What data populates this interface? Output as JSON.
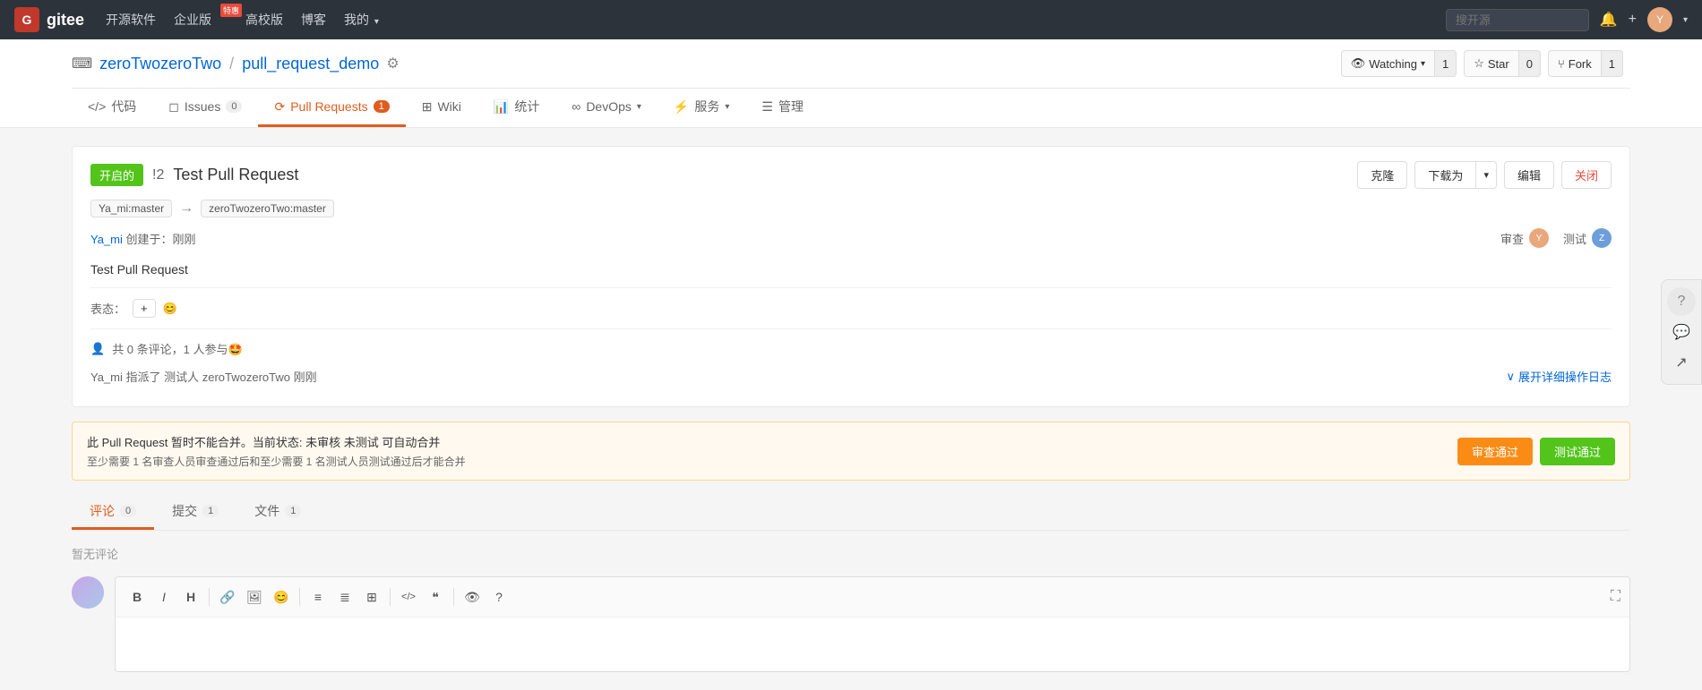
{
  "topnav": {
    "brand": "gitee",
    "logo_letter": "G",
    "links": [
      {
        "label": "开源软件",
        "id": "opensource"
      },
      {
        "label": "企业版",
        "id": "enterprise",
        "badge": "特惠"
      },
      {
        "label": "高校版",
        "id": "edu"
      },
      {
        "label": "博客",
        "id": "blog"
      },
      {
        "label": "我的",
        "id": "mine",
        "dropdown": true
      }
    ],
    "search_placeholder": "搜开源"
  },
  "repo": {
    "icon": "⬛",
    "owner": "zeroTwozeroTwo",
    "name": "pull_request_demo",
    "watching_label": "Watching",
    "watching_count": "1",
    "star_label": "Star",
    "star_count": "0",
    "fork_label": "Fork",
    "fork_count": "1"
  },
  "tabs": [
    {
      "label": "代码",
      "id": "code",
      "badge": null
    },
    {
      "label": "Issues",
      "id": "issues",
      "badge": "0"
    },
    {
      "label": "Pull Requests",
      "id": "pull_requests",
      "badge": "1",
      "active": true
    },
    {
      "label": "Wiki",
      "id": "wiki",
      "badge": null
    },
    {
      "label": "统计",
      "id": "stats",
      "badge": null
    },
    {
      "label": "DevOps",
      "id": "devops",
      "badge": null,
      "dropdown": true
    },
    {
      "label": "服务",
      "id": "services",
      "badge": null,
      "dropdown": true
    },
    {
      "label": "管理",
      "id": "manage",
      "badge": null
    }
  ],
  "pr": {
    "status": "开启的",
    "number": "!2",
    "title": "Test Pull Request",
    "from_branch": "Ya_mi:master",
    "to_branch": "zeroTwozeroTwo:master",
    "arrow": "→",
    "author": "Ya_mi",
    "created_at": "创建于：刚刚",
    "review_label": "审查",
    "test_label": "测试",
    "description": "Test Pull Request",
    "reaction_label": "表态：",
    "plus_icon": "+",
    "smile_icon": "😊",
    "comments_summary": "共 0 条评论，1 人参与🤩",
    "assignee_prefix": "Ya_mi 指派了 测试人 zeroTwozeroTwo 刚刚",
    "expand_log": "展开详细操作日志",
    "merge_notice_title": "此 Pull Request 暂时不能合并。当前状态: 未审核 未测试 可自动合并",
    "merge_notice_detail": "至少需要 1 名审查人员审查通过后和至少需要 1 名测试人员测试通过后才能合并",
    "review_pass_btn": "审查通过",
    "test_pass_btn": "测试通过",
    "sub_tabs": [
      {
        "label": "评论",
        "badge": "0",
        "active": true
      },
      {
        "label": "提交",
        "badge": "1"
      },
      {
        "label": "文件",
        "badge": "1"
      }
    ],
    "no_comments": "暂无评论",
    "editor_toolbar": [
      {
        "icon": "B",
        "name": "bold"
      },
      {
        "icon": "I",
        "name": "italic"
      },
      {
        "icon": "H",
        "name": "heading"
      },
      {
        "icon": "🔗",
        "name": "link"
      },
      {
        "icon": "🖼",
        "name": "image"
      },
      {
        "icon": "😊",
        "name": "emoji"
      },
      {
        "icon": "≡",
        "name": "list-unordered"
      },
      {
        "icon": "≣",
        "name": "list-ordered"
      },
      {
        "icon": "⊞",
        "name": "table"
      },
      {
        "icon": "</>",
        "name": "code"
      },
      {
        "icon": "❝",
        "name": "quote"
      },
      {
        "icon": "👁",
        "name": "preview"
      },
      {
        "icon": "?",
        "name": "help"
      }
    ]
  },
  "float_sidebar": [
    {
      "icon": "?",
      "name": "help"
    },
    {
      "icon": "💬",
      "name": "chat"
    },
    {
      "icon": "↗",
      "name": "external"
    }
  ]
}
